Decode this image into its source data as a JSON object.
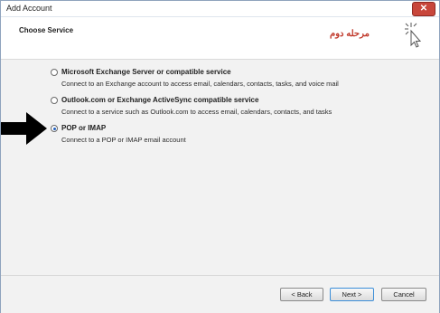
{
  "window": {
    "title": "Add Account",
    "close_label": "✕"
  },
  "header": {
    "section_title": "Choose Service",
    "annotation": "مرحله دوم"
  },
  "options": [
    {
      "label": "Microsoft Exchange Server or compatible service",
      "description": "Connect to an Exchange account to access email, calendars, contacts, tasks, and voice mail",
      "selected": false
    },
    {
      "label": "Outlook.com or Exchange ActiveSync compatible service",
      "description": "Connect to a service such as Outlook.com to access email, calendars, contacts, and tasks",
      "selected": false
    },
    {
      "label": "POP or IMAP",
      "description": "Connect to a POP or IMAP email account",
      "selected": true
    }
  ],
  "footer": {
    "back_label": "< Back",
    "next_label": "Next >",
    "cancel_label": "Cancel"
  },
  "colors": {
    "annotation": "#c0392b",
    "close": "#c8463b",
    "radio_dot": "#1f5fbf"
  }
}
